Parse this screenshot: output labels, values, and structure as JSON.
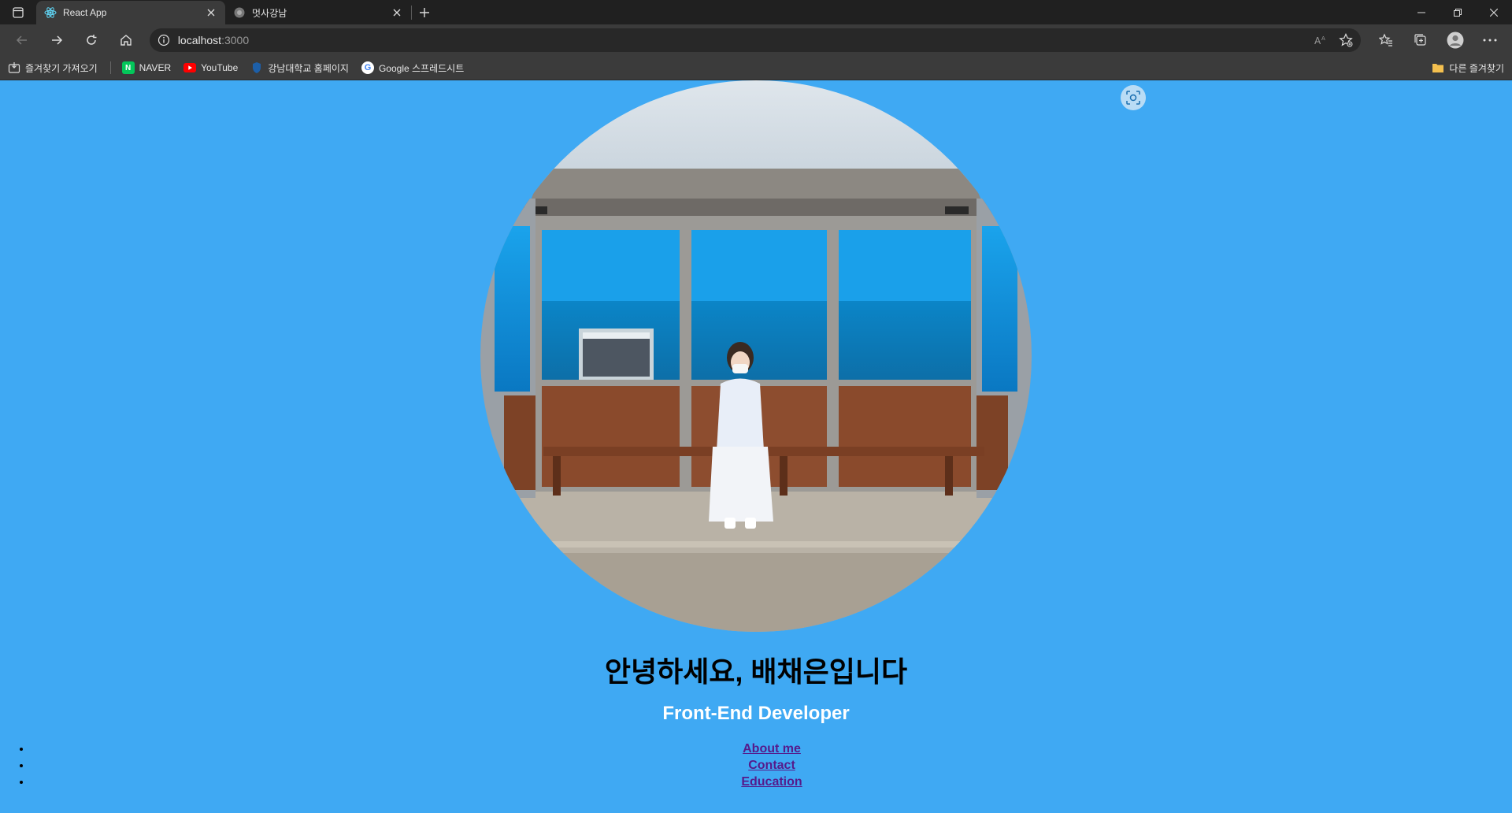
{
  "browser": {
    "tabs": [
      {
        "title": "React App",
        "active": true,
        "favicon": "react-icon"
      },
      {
        "title": "멋사강남",
        "active": false,
        "favicon": "loading-icon"
      }
    ],
    "address": {
      "host": "localhost",
      "port": ":3000"
    },
    "bookmarks": [
      {
        "label": "즐겨찾기 가져오기",
        "icon": "import-icon"
      },
      {
        "label": "NAVER",
        "icon": "naver-icon",
        "color": "#03c75a"
      },
      {
        "label": "YouTube",
        "icon": "youtube-icon",
        "color": "#ff0000"
      },
      {
        "label": "강남대학교 홈페이지",
        "icon": "shield-icon"
      },
      {
        "label": "Google 스프레드시트",
        "icon": "google-icon"
      }
    ],
    "other_bookmarks": "다른 즐겨찾기"
  },
  "hero": {
    "greeting": "안녕하세요, 배채은입니다",
    "role": "Front-End Developer"
  },
  "nav": {
    "items": [
      "About me",
      "Contact",
      "Education"
    ]
  },
  "colors": {
    "page_bg": "#3fa9f3",
    "link": "#551a8b",
    "role_text": "#ffffff"
  }
}
